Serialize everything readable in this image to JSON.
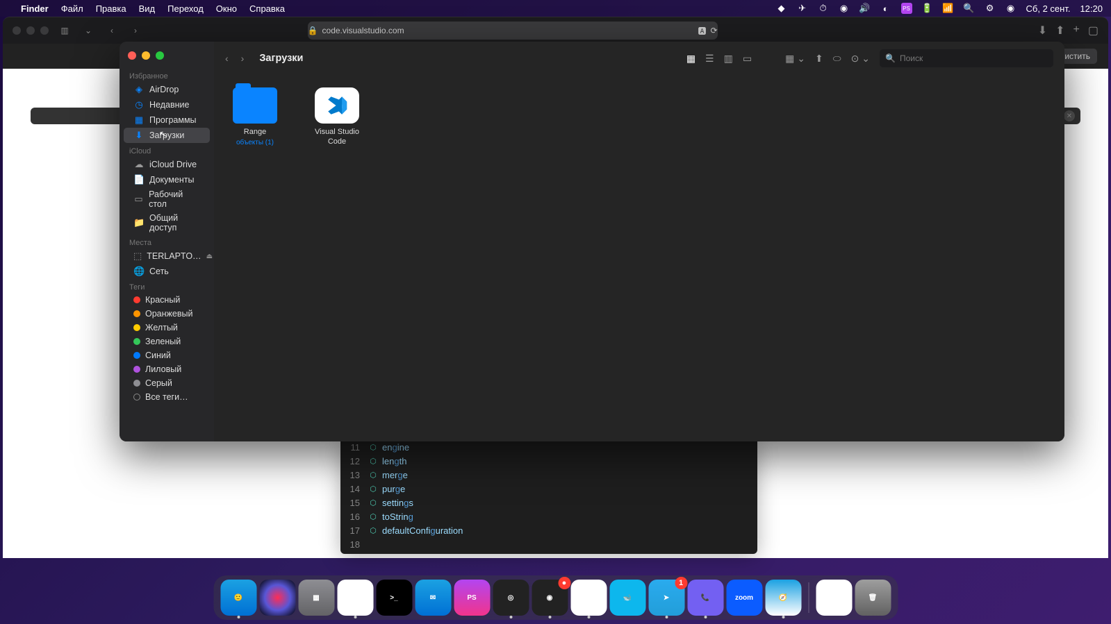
{
  "menubar": {
    "app": "Finder",
    "menus": [
      "Файл",
      "Правка",
      "Вид",
      "Переход",
      "Окно",
      "Справка"
    ],
    "date": "Сб, 2 сент.",
    "time": "12:20"
  },
  "safari": {
    "url": "code.visualstudio.com",
    "clear_btn": "Очистить"
  },
  "finder": {
    "title": "Загрузки",
    "search_placeholder": "Поиск",
    "sidebar": {
      "favs_header": "Избранное",
      "favs": [
        {
          "icon": "airdrop",
          "label": "AirDrop"
        },
        {
          "icon": "clock",
          "label": "Недавние"
        },
        {
          "icon": "apps",
          "label": "Программы"
        },
        {
          "icon": "downloads",
          "label": "Загрузки",
          "active": true
        }
      ],
      "icloud_header": "iCloud",
      "icloud": [
        {
          "icon": "cloud",
          "label": "iCloud Drive"
        },
        {
          "icon": "doc",
          "label": "Документы"
        },
        {
          "icon": "desktop",
          "label": "Рабочий стол"
        },
        {
          "icon": "folder",
          "label": "Общий доступ"
        }
      ],
      "places_header": "Места",
      "places": [
        {
          "icon": "disk",
          "label": "TERLAPTO…",
          "eject": true
        },
        {
          "icon": "globe",
          "label": "Сеть"
        }
      ],
      "tags_header": "Теги",
      "tags": [
        {
          "color": "#ff3b30",
          "label": "Красный"
        },
        {
          "color": "#ff9500",
          "label": "Оранжевый"
        },
        {
          "color": "#ffcc00",
          "label": "Желтый"
        },
        {
          "color": "#34c759",
          "label": "Зеленый"
        },
        {
          "color": "#007aff",
          "label": "Синий"
        },
        {
          "color": "#af52de",
          "label": "Лиловый"
        },
        {
          "color": "#8e8e93",
          "label": "Серый"
        },
        {
          "color": "",
          "label": "Все теги…"
        }
      ]
    },
    "files": [
      {
        "type": "folder",
        "name": "Range",
        "sub": "объекты (1)"
      },
      {
        "type": "app",
        "name": "Visual Studio Code"
      }
    ]
  },
  "code": {
    "lines": [
      {
        "n": "11",
        "text": "engine"
      },
      {
        "n": "12",
        "text": "length"
      },
      {
        "n": "13",
        "text": "merge"
      },
      {
        "n": "14",
        "text": "purge"
      },
      {
        "n": "15",
        "text": "settings"
      },
      {
        "n": "16",
        "text": "toString"
      },
      {
        "n": "17",
        "text": "defaultConfiguration"
      },
      {
        "n": "18",
        "text": ""
      }
    ]
  },
  "dock": {
    "items": [
      {
        "name": "finder",
        "bg": "linear-gradient(#1ba1e2,#0070d4)",
        "running": true,
        "label": "🙂"
      },
      {
        "name": "siri",
        "bg": "radial-gradient(circle,#ff2d55,#5856d6,#000)",
        "label": ""
      },
      {
        "name": "launchpad",
        "bg": "linear-gradient(#8e8e93,#636366)",
        "label": "▦"
      },
      {
        "name": "chrome",
        "bg": "#fff",
        "running": true,
        "label": "◉"
      },
      {
        "name": "terminal",
        "bg": "#000",
        "label": ">_"
      },
      {
        "name": "mail",
        "bg": "linear-gradient(#1ba1e2,#0070d4)",
        "label": "✉"
      },
      {
        "name": "phpstorm",
        "bg": "linear-gradient(#b345f1,#f1348b)",
        "label": "PS"
      },
      {
        "name": "obs",
        "bg": "#222",
        "running": true,
        "label": "◎"
      },
      {
        "name": "obs2",
        "bg": "#222",
        "running": true,
        "label": "◉",
        "badge": "●"
      },
      {
        "name": "slack",
        "bg": "#fff",
        "running": true,
        "label": "✱"
      },
      {
        "name": "docker",
        "bg": "#0db7ed",
        "label": "🐋"
      },
      {
        "name": "telegram",
        "bg": "linear-gradient(#2aabee,#229ed9)",
        "running": true,
        "badge": "1",
        "label": "➤"
      },
      {
        "name": "viber",
        "bg": "#7360f2",
        "running": true,
        "label": "📞"
      },
      {
        "name": "zoom",
        "bg": "#0b5cff",
        "label": "zoom"
      },
      {
        "name": "safari",
        "bg": "linear-gradient(#1ba1e2,#fff)",
        "running": true,
        "label": "🧭"
      }
    ],
    "right": [
      {
        "name": "vscode",
        "bg": "#fff",
        "label": "⟨⟩"
      },
      {
        "name": "trash",
        "bg": "linear-gradient(#9e9e9e,#616161)",
        "label": "🗑"
      }
    ]
  }
}
